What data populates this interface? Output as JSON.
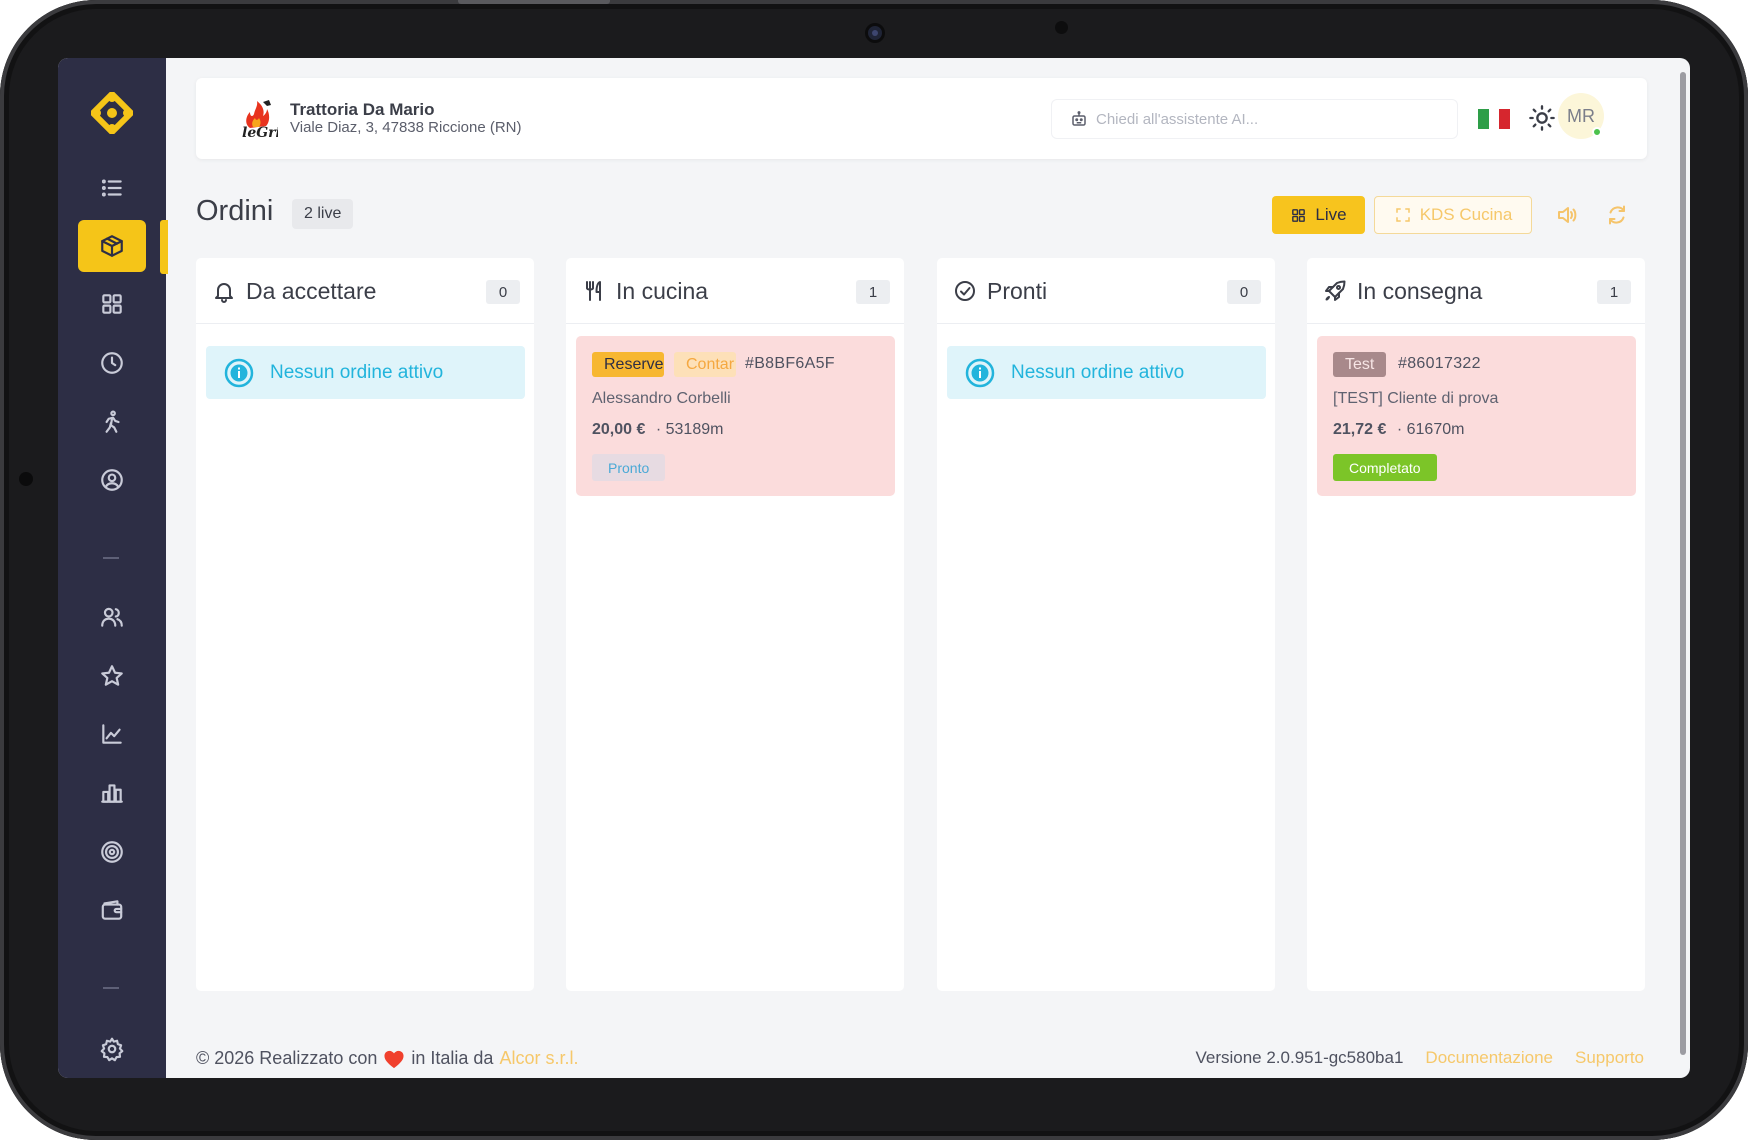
{
  "restaurant": {
    "name": "Trattoria Da Mario",
    "address": "Viale Diaz, 3, 47838 Riccione (RN)"
  },
  "search": {
    "placeholder": "Chiedi all'assistente AI..."
  },
  "user": {
    "initials": "MR",
    "online": true
  },
  "page": {
    "title": "Ordini",
    "live_badge": "2 live"
  },
  "actions": {
    "live": "Live",
    "kds": "KDS Cucina"
  },
  "colors": {
    "accent": "#f5c518",
    "sidebar": "#2d2e45",
    "info": "#22b4dc",
    "card": "#fbdcdc"
  },
  "sidebar": {
    "items": [
      {
        "icon": "list-icon"
      },
      {
        "icon": "package-icon",
        "active": true
      },
      {
        "icon": "grid-icon"
      },
      {
        "icon": "clock-icon"
      },
      {
        "icon": "walking-icon"
      },
      {
        "icon": "user-circle-icon"
      },
      {
        "icon": "users-icon"
      },
      {
        "icon": "star-icon"
      },
      {
        "icon": "chart-line-icon"
      },
      {
        "icon": "bar-chart-icon"
      },
      {
        "icon": "target-icon"
      },
      {
        "icon": "wallet-icon"
      },
      {
        "icon": "settings-icon"
      }
    ]
  },
  "columns": [
    {
      "title": "Da accettare",
      "count": "0",
      "empty": "Nessun ordine attivo"
    },
    {
      "title": "In cucina",
      "count": "1",
      "order": {
        "tags": [
          "Reserve",
          "Contar"
        ],
        "code": "#B8BF6A5F",
        "customer": "Alessandro Corbelli",
        "price": "20,00 €",
        "distance": "· 53189m",
        "status": "Pronto"
      }
    },
    {
      "title": "Pronti",
      "count": "0",
      "empty": "Nessun ordine attivo"
    },
    {
      "title": "In consegna",
      "count": "1",
      "order": {
        "tags": [
          "Test"
        ],
        "code": "#86017322",
        "customer": "[TEST] Cliente di prova",
        "price": "21,72 €",
        "distance": "· 61670m",
        "status": "Completato"
      }
    }
  ],
  "footer": {
    "copyright_pre": "© 2026 Realizzato con",
    "copyright_mid": "in Italia da",
    "company": "Alcor s.r.l.",
    "version": "Versione 2.0.951-gc580ba1",
    "docs": "Documentazione",
    "support": "Supporto"
  }
}
